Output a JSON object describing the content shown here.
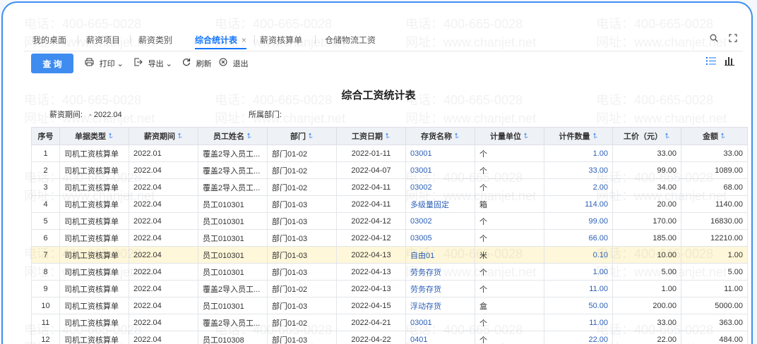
{
  "tabs": [
    {
      "label": "我的桌面",
      "active": false
    },
    {
      "label": "薪资项目",
      "active": false
    },
    {
      "label": "薪资类别",
      "active": false
    },
    {
      "label": "综合统计表",
      "active": true
    },
    {
      "label": "薪资核算单",
      "active": false
    },
    {
      "label": "仓储物流工资",
      "active": false
    }
  ],
  "tab_close_glyph": "×",
  "tab_icons": {
    "search": "search-icon",
    "expand": "expand-icon"
  },
  "toolbar": {
    "query_label": "查 询",
    "print_label": "打印",
    "export_label": "导出",
    "refresh_label": "刷新",
    "exit_label": "退出"
  },
  "report": {
    "title": "综合工资统计表",
    "period_label": "薪资期间:",
    "period_value": "- 2022.04",
    "dept_label": "所属部门:"
  },
  "table": {
    "columns": [
      "序号",
      "单据类型",
      "薪资期间",
      "员工姓名",
      "部门",
      "工资日期",
      "存货名称",
      "计量单位",
      "计件数量",
      "工价（元）",
      "金额"
    ],
    "rows": [
      [
        "1",
        "司机工资核算单",
        "2022.01",
        "覆盖2导入员工...",
        "部门01-02",
        "2022-01-11",
        "03001",
        "个",
        "1.00",
        "33.00",
        "33.00"
      ],
      [
        "2",
        "司机工资核算单",
        "2022.04",
        "覆盖2导入员工...",
        "部门01-02",
        "2022-04-07",
        "03001",
        "个",
        "33.00",
        "99.00",
        "1089.00"
      ],
      [
        "3",
        "司机工资核算单",
        "2022.04",
        "覆盖2导入员工...",
        "部门01-02",
        "2022-04-11",
        "03002",
        "个",
        "2.00",
        "34.00",
        "68.00"
      ],
      [
        "4",
        "司机工资核算单",
        "2022.04",
        "员工010301",
        "部门01-03",
        "2022-04-11",
        "多级量固定",
        "箱",
        "114.00",
        "20.00",
        "1140.00"
      ],
      [
        "5",
        "司机工资核算单",
        "2022.04",
        "员工010301",
        "部门01-03",
        "2022-04-12",
        "03002",
        "个",
        "99.00",
        "170.00",
        "16830.00"
      ],
      [
        "6",
        "司机工资核算单",
        "2022.04",
        "员工010301",
        "部门01-03",
        "2022-04-12",
        "03005",
        "个",
        "66.00",
        "185.00",
        "12210.00"
      ],
      [
        "7",
        "司机工资核算单",
        "2022.04",
        "员工010301",
        "部门01-03",
        "2022-04-13",
        "自由01",
        "米",
        "0.10",
        "10.00",
        "1.00"
      ],
      [
        "8",
        "司机工资核算单",
        "2022.04",
        "员工010301",
        "部门01-03",
        "2022-04-13",
        "劳务存货",
        "个",
        "1.00",
        "5.00",
        "5.00"
      ],
      [
        "9",
        "司机工资核算单",
        "2022.04",
        "覆盖2导入员工...",
        "部门01-02",
        "2022-04-13",
        "劳务存货",
        "个",
        "11.00",
        "1.00",
        "11.00"
      ],
      [
        "10",
        "司机工资核算单",
        "2022.04",
        "员工010301",
        "部门01-03",
        "2022-04-15",
        "浮动存货",
        "盒",
        "50.00",
        "200.00",
        "5000.00"
      ],
      [
        "11",
        "司机工资核算单",
        "2022.04",
        "覆盖2导入员工...",
        "部门01-02",
        "2022-04-21",
        "03001",
        "个",
        "11.00",
        "33.00",
        "363.00"
      ],
      [
        "12",
        "司机工资核算单",
        "2022.04",
        "员工010308",
        "部门01-03",
        "2022-04-22",
        "0401",
        "个",
        "22.00",
        "22.00",
        "484.00"
      ]
    ],
    "highlight_row": 7,
    "highlight_color": "#fff7d9"
  },
  "watermark": {
    "phone": "电话：400-665-0028",
    "site": "网址：www.chanjet.net"
  },
  "colors": {
    "accent": "#1677ff",
    "frame": "#3e8ff0",
    "link": "#2b5fb8"
  }
}
